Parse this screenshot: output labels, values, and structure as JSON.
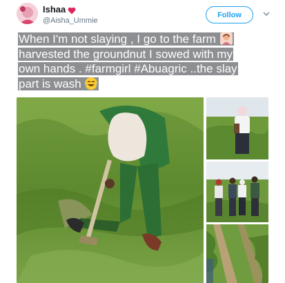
{
  "user": {
    "display_name": "Ishaa",
    "handle": "@Aisha_Ummie",
    "name_emoji": "red-heart-icon",
    "avatar": "profile-avatar"
  },
  "header": {
    "follow_label": "Follow",
    "menu_icon": "chevron-down-icon"
  },
  "tweet": {
    "line1": "When I'm not slaying , I go to the farm ",
    "line1_emoji": "woman-farmer-emoji",
    "line2": "harvested the groundnut I sowed with my",
    "line3": "own hands . #farmgirl #Abuagric ..the slay",
    "line4": "part is wash ",
    "line4_emoji": "tears-of-joy-emoji"
  },
  "media": {
    "photos": [
      "farm-photo-woman-hoeing",
      "farm-photo-woman-standing",
      "farm-photo-group",
      "farm-photo-crop-rows"
    ]
  },
  "colors": {
    "link_blue": "#1da1f2",
    "text_highlight": "#8d8f92",
    "handle_gray": "#657786",
    "heart_red": "#e0245e"
  }
}
